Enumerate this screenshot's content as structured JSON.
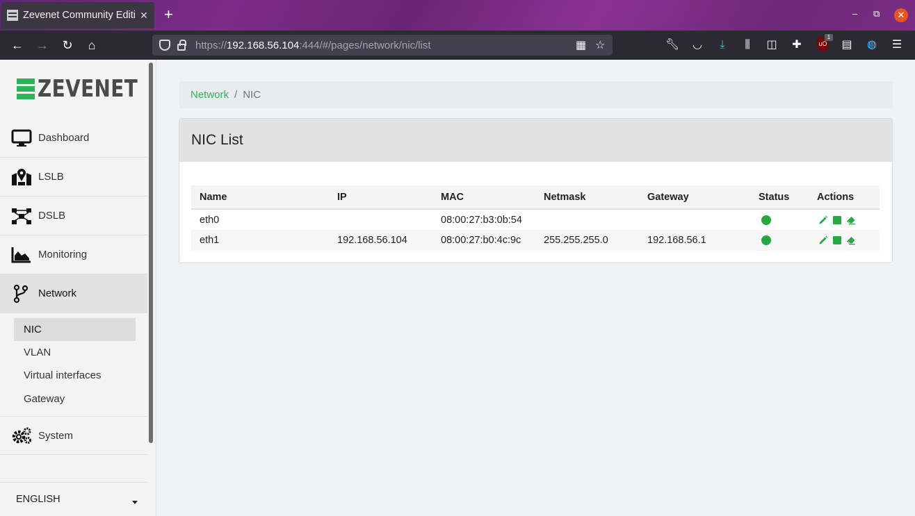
{
  "browser": {
    "tab_title": "Zevenet Community Editi",
    "tab_close": "✕",
    "new_tab": "+",
    "url_prefix": "https://",
    "url_host": "192.168.56.104",
    "url_rest": ":444/#/pages/network/nic/list",
    "ublock_badge": "1"
  },
  "sidebar": {
    "logo_text": "ZEVENET",
    "menu": [
      {
        "label": "Dashboard",
        "icon": "monitor-icon"
      },
      {
        "label": "LSLB",
        "icon": "map-marker-icon"
      },
      {
        "label": "DSLB",
        "icon": "network-nodes-icon"
      },
      {
        "label": "Monitoring",
        "icon": "area-chart-icon"
      },
      {
        "label": "Network",
        "icon": "branch-icon"
      },
      {
        "label": "System",
        "icon": "gears-icon"
      }
    ],
    "submenu": [
      {
        "label": "NIC"
      },
      {
        "label": "VLAN"
      },
      {
        "label": "Virtual interfaces"
      },
      {
        "label": "Gateway"
      }
    ],
    "language": "ENGLISH"
  },
  "breadcrumb": {
    "parent": "Network",
    "separator": "/",
    "current": "NIC"
  },
  "card": {
    "title": "NIC List",
    "columns": [
      "Name",
      "IP",
      "MAC",
      "Netmask",
      "Gateway",
      "Status",
      "Actions"
    ],
    "rows": [
      {
        "name": "eth0",
        "ip": "",
        "mac": "08:00:27:b3:0b:54",
        "netmask": "",
        "gateway": "",
        "status": "up"
      },
      {
        "name": "eth1",
        "ip": "192.168.56.104",
        "mac": "08:00:27:b0:4c:9c",
        "netmask": "255.255.255.0",
        "gateway": "192.168.56.1",
        "status": "up"
      }
    ]
  },
  "colors": {
    "accent": "#2eb35b",
    "status_up": "#27a845"
  }
}
